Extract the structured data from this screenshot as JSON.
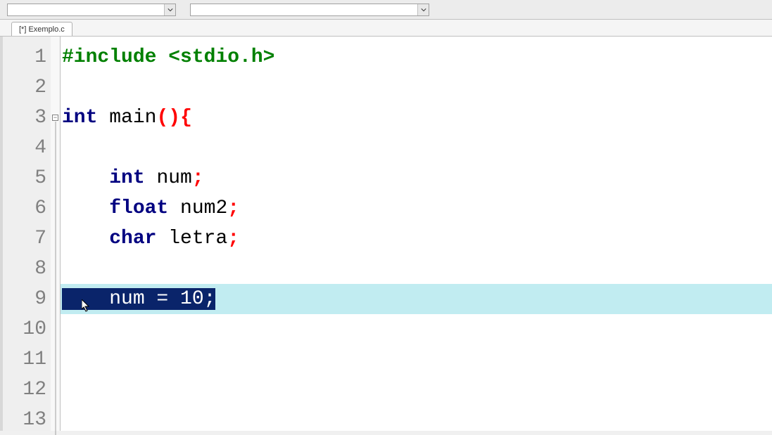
{
  "toolbar": {
    "combo1_value": "",
    "combo2_value": ""
  },
  "tab": {
    "label": "[*] Exemplo.c"
  },
  "code": {
    "lines": [
      {
        "num": "1",
        "tokens": [
          {
            "t": "#include ",
            "c": "preproc"
          },
          {
            "t": "<stdio.h>",
            "c": "preproc"
          }
        ]
      },
      {
        "num": "2",
        "tokens": []
      },
      {
        "num": "3",
        "fold": true,
        "tokens": [
          {
            "t": "int",
            "c": "type"
          },
          {
            "t": " ",
            "c": "ident"
          },
          {
            "t": "main",
            "c": "ident"
          },
          {
            "t": "()",
            "c": "punct"
          },
          {
            "t": "{",
            "c": "punct"
          }
        ]
      },
      {
        "num": "4",
        "tokens": []
      },
      {
        "num": "5",
        "tokens": [
          {
            "t": "    ",
            "c": "ident"
          },
          {
            "t": "int",
            "c": "type"
          },
          {
            "t": " ",
            "c": "ident"
          },
          {
            "t": "num",
            "c": "ident"
          },
          {
            "t": ";",
            "c": "punct"
          }
        ]
      },
      {
        "num": "6",
        "tokens": [
          {
            "t": "    ",
            "c": "ident"
          },
          {
            "t": "float",
            "c": "type"
          },
          {
            "t": " ",
            "c": "ident"
          },
          {
            "t": "num2",
            "c": "ident"
          },
          {
            "t": ";",
            "c": "punct"
          }
        ]
      },
      {
        "num": "7",
        "tokens": [
          {
            "t": "    ",
            "c": "ident"
          },
          {
            "t": "char",
            "c": "type"
          },
          {
            "t": " ",
            "c": "ident"
          },
          {
            "t": "letra",
            "c": "ident"
          },
          {
            "t": ";",
            "c": "punct"
          }
        ]
      },
      {
        "num": "8",
        "tokens": []
      },
      {
        "num": "9",
        "highlighted": true,
        "selected": true,
        "sel_text": "    num = 10;",
        "tokens": []
      },
      {
        "num": "10",
        "tokens": []
      },
      {
        "num": "11",
        "tokens": []
      },
      {
        "num": "12",
        "tokens": []
      },
      {
        "num": "13",
        "tokens": []
      }
    ]
  },
  "fold_symbol": "−"
}
